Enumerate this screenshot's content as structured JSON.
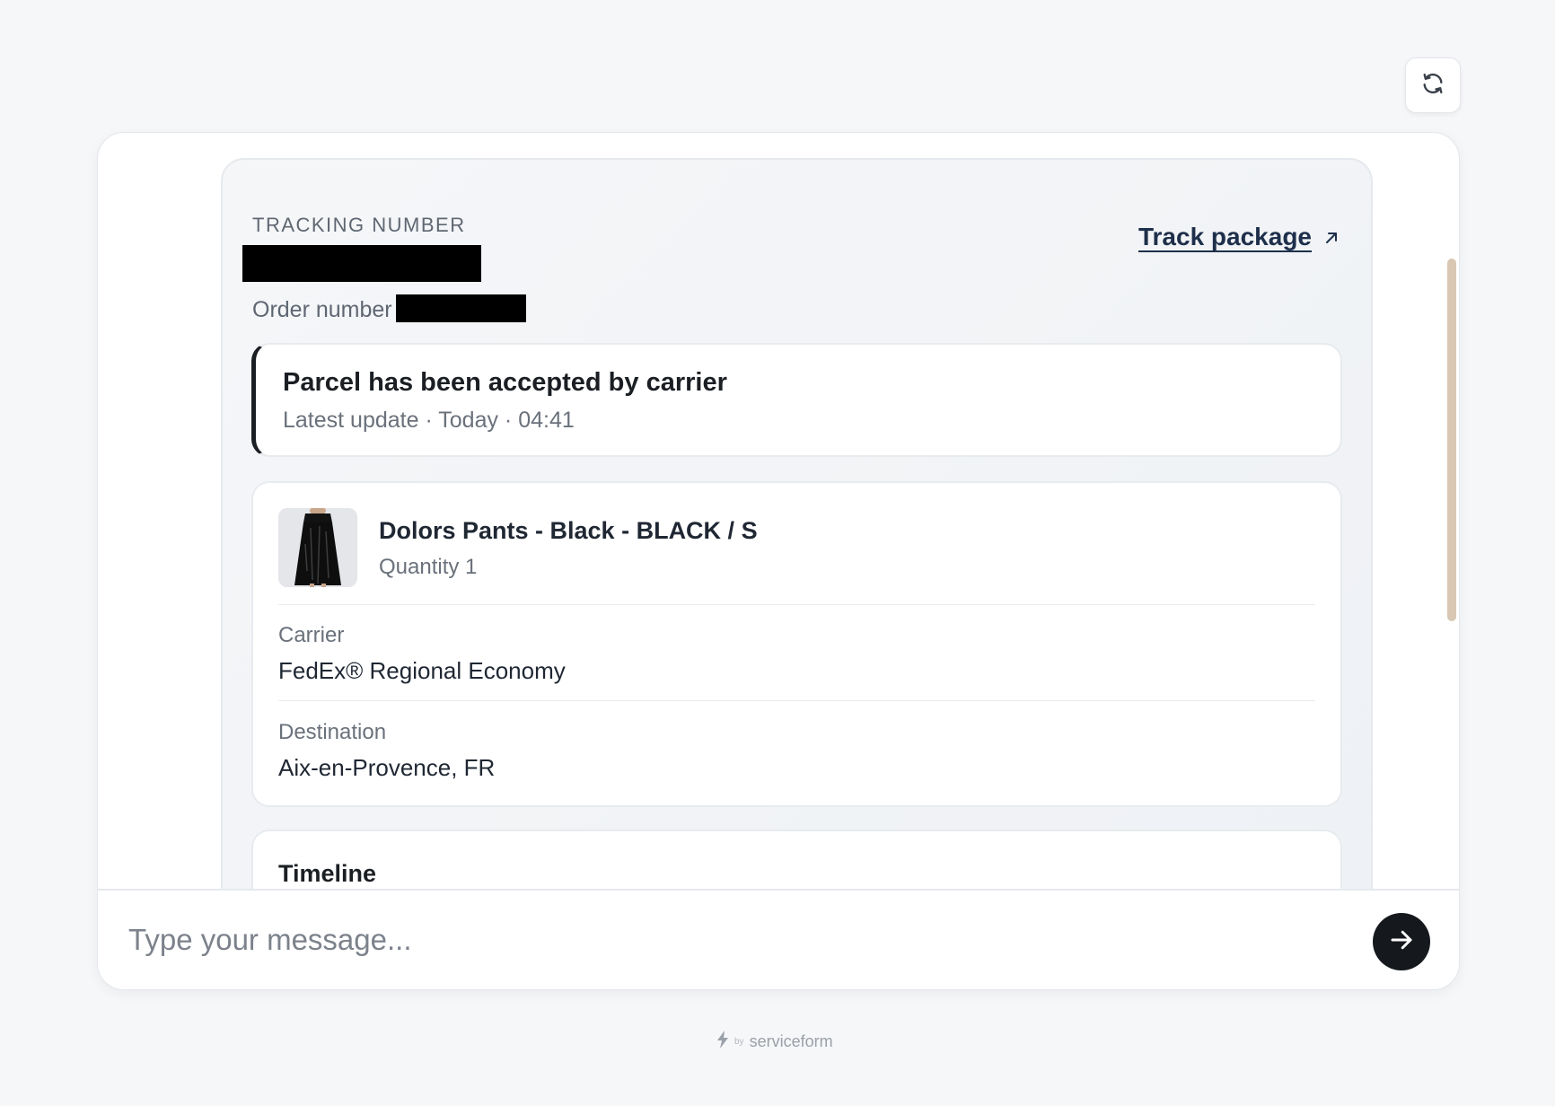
{
  "header": {
    "refresh_icon": "refresh-icon"
  },
  "tracking": {
    "label": "TRACKING NUMBER",
    "order_label": "Order number",
    "track_link_label": "Track package",
    "track_link_icon": "arrow-up-right-icon"
  },
  "status": {
    "title": "Parcel has been accepted by carrier",
    "subtitle": "Latest update · Today · 04:41",
    "accent_color": "#1b1f24"
  },
  "item": {
    "name": "Dolors Pants - Black - BLACK / S",
    "quantity": "Quantity 1",
    "carrier_label": "Carrier",
    "carrier_value": "FedEx® Regional Economy",
    "destination_label": "Destination",
    "destination_value": "Aix-en-Provence, FR"
  },
  "timeline": {
    "title": "Timeline"
  },
  "composer": {
    "placeholder": "Type your message...",
    "send_icon": "arrow-right-icon"
  },
  "footer": {
    "by": "by",
    "brand": "serviceform"
  },
  "colors": {
    "scrollbar": "#d8c7b3",
    "send_button": "#15181c",
    "link": "#1e2f4b"
  }
}
